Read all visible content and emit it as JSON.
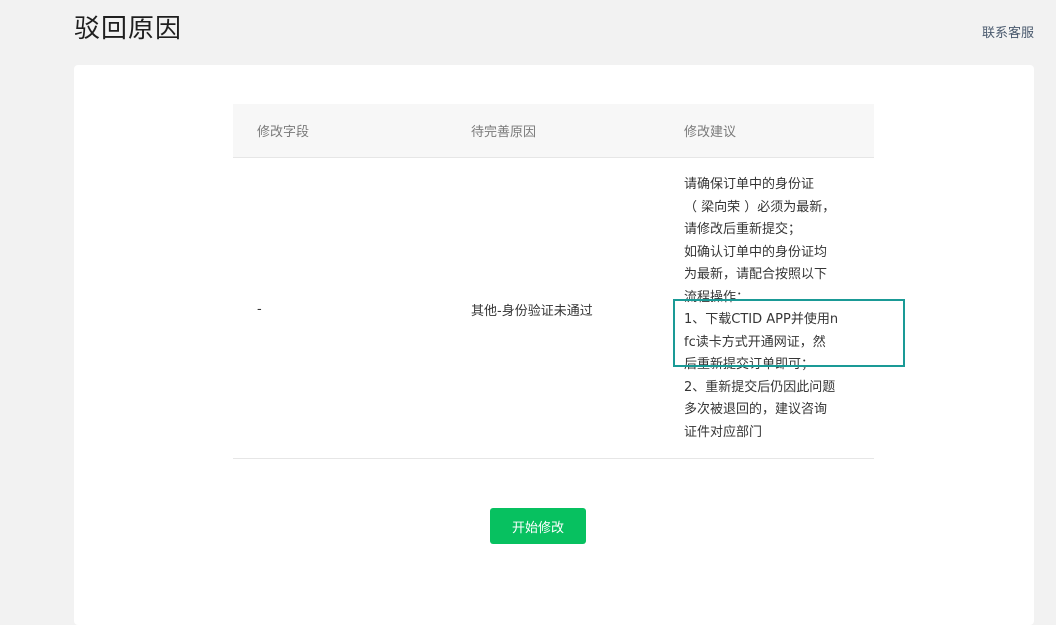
{
  "header": {
    "title": "驳回原因",
    "contact_label": "联系客服"
  },
  "table": {
    "columns": [
      "修改字段",
      "待完善原因",
      "修改建议"
    ],
    "rows": [
      {
        "field": "-",
        "reason": "其他-身份验证未通过",
        "suggestion_lines": [
          "请确保订单中的身份证",
          "（ 梁向荣 ）必须为最新，",
          "请修改后重新提交；",
          "如确认订单中的身份证均",
          "为最新，请配合按照以下",
          "流程操作：",
          "1、下载CTID APP并使用n",
          "fc读卡方式开通网证，然",
          "后重新提交订单即可；",
          "2、重新提交后仍因此问题",
          "多次被退回的，建议咨询",
          "证件对应部门"
        ]
      }
    ]
  },
  "actions": {
    "start_label": "开始修改"
  },
  "colors": {
    "accent": "#07c160",
    "highlight_border": "#1a9a96"
  }
}
